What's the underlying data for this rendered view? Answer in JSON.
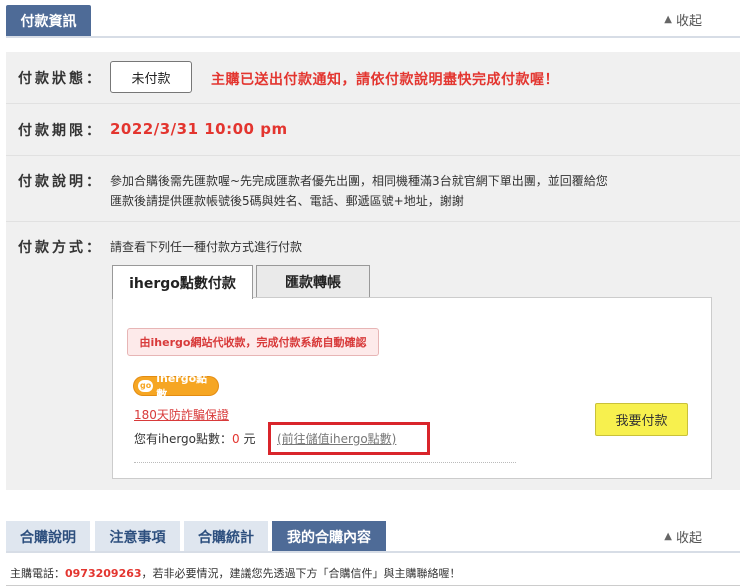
{
  "section": {
    "title": "付款資訊",
    "collapse_label": "收起",
    "collapse_icon": "triangle-up-icon"
  },
  "rows": {
    "status": {
      "label": "付款狀態：",
      "value": "未付款",
      "message": "主購已送出付款通知，請依付款說明盡快完成付款喔！"
    },
    "deadline": {
      "label": "付款期限：",
      "value": "2022/3/31  10:00 pm"
    },
    "description": {
      "label": "付款說明：",
      "lines": [
        "參加合購後需先匯款喔~先完成匯款者優先出團，相同機種滿3台就官網下單出團，並回覆給您",
        "匯款後請提供匯款帳號後5碼與姓名、電話、郵遞區號+地址，謝謝"
      ]
    },
    "method": {
      "label": "付款方式：",
      "lead": "請查看下列任一種付款方式進行付款"
    }
  },
  "payment_tabs": [
    {
      "label": "ihergo點數付款",
      "active": true
    },
    {
      "label": "匯款轉帳",
      "active": false
    }
  ],
  "ihergo_pay": {
    "notice": "由ihergo網站代收款，完成付款系統自動確認",
    "logo_text": "ihergo點數",
    "logo_go": "go",
    "anti_scam_link": "180天防詐騙保證",
    "points_prefix": "您有ihergo點數：",
    "points_value": "0",
    "points_unit": " 元",
    "topup_link": "(前往儲值ihergo點數)",
    "pay_button": "我要付款"
  },
  "bottom_tabs": [
    {
      "label": "合購說明",
      "active": false
    },
    {
      "label": "注意事項",
      "active": false
    },
    {
      "label": "合購統計",
      "active": false
    },
    {
      "label": "我的合購內容",
      "active": true
    }
  ],
  "bottom_collapse_label": "收起",
  "footer": {
    "prefix": "主購電話：",
    "phone": "0973209263",
    "suffix": "，若非必要情況，建議您先透過下方「合購信件」與主購聯絡喔！"
  },
  "colors": {
    "tab_blue": "#4e6b97",
    "alert_red": "#e3352f",
    "pay_yellow": "#f7f04e",
    "highlight_red": "#d9252b"
  }
}
